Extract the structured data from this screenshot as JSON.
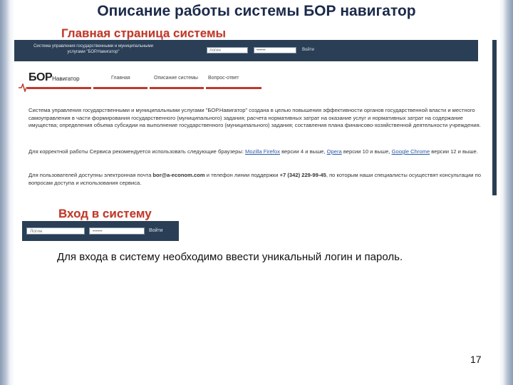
{
  "slide": {
    "title": "Описание работы системы БОР навигатор",
    "subtitle_main": "Главная страница системы",
    "subtitle_login": "Вход в систему",
    "body_text": "Для входа в систему необходимо ввести уникальный логин и пароль.",
    "page_number": "17"
  },
  "screenshot": {
    "topbar": {
      "system_name": "Система управления государственными и муниципальными услугами \"БОР.Навигатор\"",
      "login_placeholder": "логин",
      "password_mask": "••••••",
      "enter_link": "Войти"
    },
    "logo": {
      "main": "БОР",
      "sub": "Навигатор"
    },
    "nav": [
      "Главная",
      "Описание системы",
      "Вопрос-ответ"
    ],
    "paragraph1": "Система управления государственными и муниципальными услугами \"БОР.Навигатор\" создана в целью повышения эффективности органов государственной власти и местного самоуправления в части формирования государственного (муниципального) задания; расчета нормативных затрат на оказание услуг и нормативных затрат на содержание имущества; определения объема субсидии на выполнение государственного (муниципального) задания; составления плана финансово-хозяйственной деятельности учреждения.",
    "paragraph2": {
      "before": "Для корректной работы Сервиса рекомендуется использовать следующие браузеры: ",
      "firefox": "Mozilla Firefox",
      "mid1": " версии 4 и выше, ",
      "opera": "Opera",
      "mid2": " версии 10 и выше, ",
      "chrome": "Google Chrome",
      "after": " версии 12 и выше."
    },
    "paragraph3": {
      "before": "Для пользователей доступны электронная почта ",
      "email": "bor@a-econom.com",
      "mid": " и телефон линии поддержки ",
      "phone": "+7 (342) 229-99-45",
      "after": ", по которым наши специалисты осуществят консультации по вопросам доступа и использования сервиса."
    }
  },
  "login_widget": {
    "login_placeholder": "Логин",
    "password_mask": "••••••",
    "button": "Войти"
  },
  "colors": {
    "accent_red": "#c0392b",
    "bar_navy": "#2a3f55",
    "title_navy": "#1c2a4a"
  }
}
